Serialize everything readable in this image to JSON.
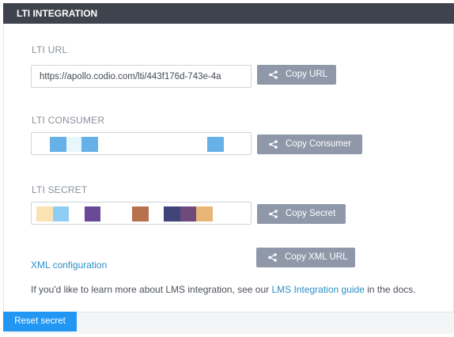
{
  "header": {
    "title": "LTI INTEGRATION"
  },
  "lti_url": {
    "label": "LTI URL",
    "value": "https://apollo.codio.com/lti/443f176d-743e-4a",
    "button": "Copy URL"
  },
  "lti_consumer": {
    "label": "LTI CONSUMER",
    "button": "Copy Consumer",
    "redaction_colors": [
      "#67b1e9",
      "#e8f7fb",
      "#67b1e9",
      "#67b1e9"
    ]
  },
  "lti_secret": {
    "label": "LTI SECRET",
    "button": "Copy Secret",
    "redaction_colors": [
      "#fbe2b3",
      "#8fcdf4",
      "#6a4a97",
      "#b7714f",
      "#3f4578",
      "#6f4a7c",
      "#e7b575"
    ]
  },
  "xml": {
    "link": "XML configuration",
    "button": "Copy XML URL"
  },
  "info": {
    "prefix": "If you'd like to learn more about LMS integration, see our ",
    "link": "LMS Integration guide",
    "suffix": " in the docs."
  },
  "footer": {
    "reset_button": "Reset secret"
  },
  "colors": {
    "header_bg": "#3f434d",
    "button_bg": "#8f98a9",
    "link": "#2b8fc8",
    "primary": "#2196f3"
  },
  "icons": {
    "copy_buttons": "share-icon"
  }
}
